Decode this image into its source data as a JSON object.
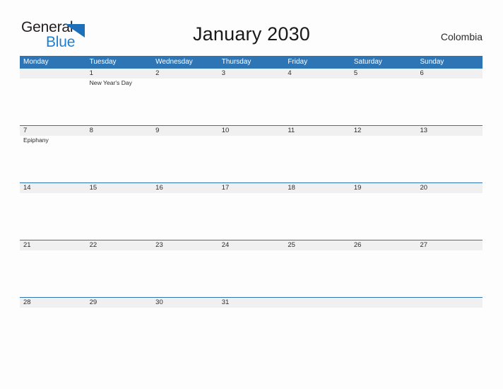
{
  "brand": {
    "line1": "General",
    "line2": "Blue",
    "mark": "triangle-flag-icon",
    "accent": "#1c7fd4"
  },
  "header": {
    "title": "January 2030",
    "region": "Colombia"
  },
  "theme": {
    "header_blue": "#2e75b6",
    "band_gray": "#f0f0f0",
    "page_bg": "#fdfdfd",
    "text": "#2b2b2b"
  },
  "calendar": {
    "weekdays": [
      "Monday",
      "Tuesday",
      "Wednesday",
      "Thursday",
      "Friday",
      "Saturday",
      "Sunday"
    ],
    "weeks": [
      [
        {
          "day": "",
          "event": ""
        },
        {
          "day": "1",
          "event": "New Year's Day"
        },
        {
          "day": "2",
          "event": ""
        },
        {
          "day": "3",
          "event": ""
        },
        {
          "day": "4",
          "event": ""
        },
        {
          "day": "5",
          "event": ""
        },
        {
          "day": "6",
          "event": ""
        }
      ],
      [
        {
          "day": "7",
          "event": "Epiphany"
        },
        {
          "day": "8",
          "event": ""
        },
        {
          "day": "9",
          "event": ""
        },
        {
          "day": "10",
          "event": ""
        },
        {
          "day": "11",
          "event": ""
        },
        {
          "day": "12",
          "event": ""
        },
        {
          "day": "13",
          "event": ""
        }
      ],
      [
        {
          "day": "14",
          "event": ""
        },
        {
          "day": "15",
          "event": ""
        },
        {
          "day": "16",
          "event": ""
        },
        {
          "day": "17",
          "event": ""
        },
        {
          "day": "18",
          "event": ""
        },
        {
          "day": "19",
          "event": ""
        },
        {
          "day": "20",
          "event": ""
        }
      ],
      [
        {
          "day": "21",
          "event": ""
        },
        {
          "day": "22",
          "event": ""
        },
        {
          "day": "23",
          "event": ""
        },
        {
          "day": "24",
          "event": ""
        },
        {
          "day": "25",
          "event": ""
        },
        {
          "day": "26",
          "event": ""
        },
        {
          "day": "27",
          "event": ""
        }
      ],
      [
        {
          "day": "28",
          "event": ""
        },
        {
          "day": "29",
          "event": ""
        },
        {
          "day": "30",
          "event": ""
        },
        {
          "day": "31",
          "event": ""
        },
        {
          "day": "",
          "event": ""
        },
        {
          "day": "",
          "event": ""
        },
        {
          "day": "",
          "event": ""
        }
      ]
    ]
  }
}
